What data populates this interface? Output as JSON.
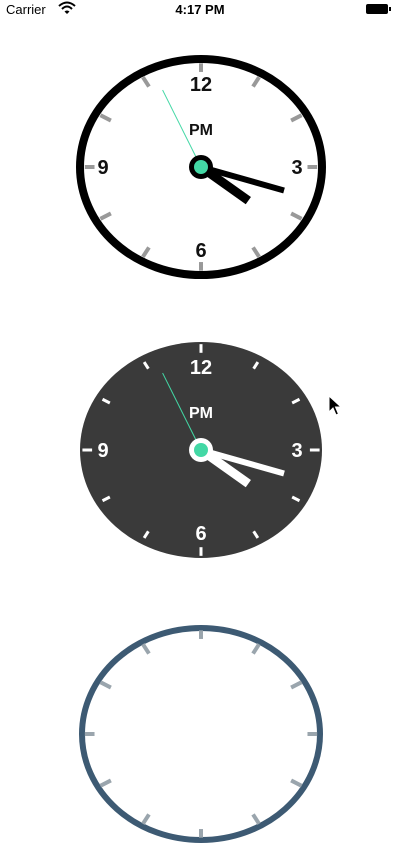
{
  "status_bar": {
    "carrier": "Carrier",
    "time": "4:17 PM"
  },
  "clocks": [
    {
      "theme": "light",
      "face_color": "#ffffff",
      "border_color": "#000000",
      "tick_color": "#999999",
      "numeral_color": "#111111",
      "hand_color": "#000000",
      "second_hand_color": "#43d8a5",
      "center_color": "#43d8a5",
      "numerals": {
        "top": "12",
        "right": "3",
        "bottom": "6",
        "left": "9"
      },
      "meridiem": "PM",
      "time": {
        "hours": 16,
        "minutes": 17,
        "seconds": 56
      }
    },
    {
      "theme": "dark",
      "face_color": "#3a3a3a",
      "border_color": "#3a3a3a",
      "tick_color": "#ffffff",
      "numeral_color": "#ffffff",
      "hand_color": "#ffffff",
      "second_hand_color": "#43d8a5",
      "center_color": "#43d8a5",
      "numerals": {
        "top": "12",
        "right": "3",
        "bottom": "6",
        "left": "9"
      },
      "meridiem": "PM",
      "time": {
        "hours": 16,
        "minutes": 17,
        "seconds": 56
      }
    },
    {
      "theme": "blue-outline",
      "face_color": "#ffffff",
      "border_color": "#3d5a73",
      "tick_color": "#9aa5ad"
    }
  ]
}
